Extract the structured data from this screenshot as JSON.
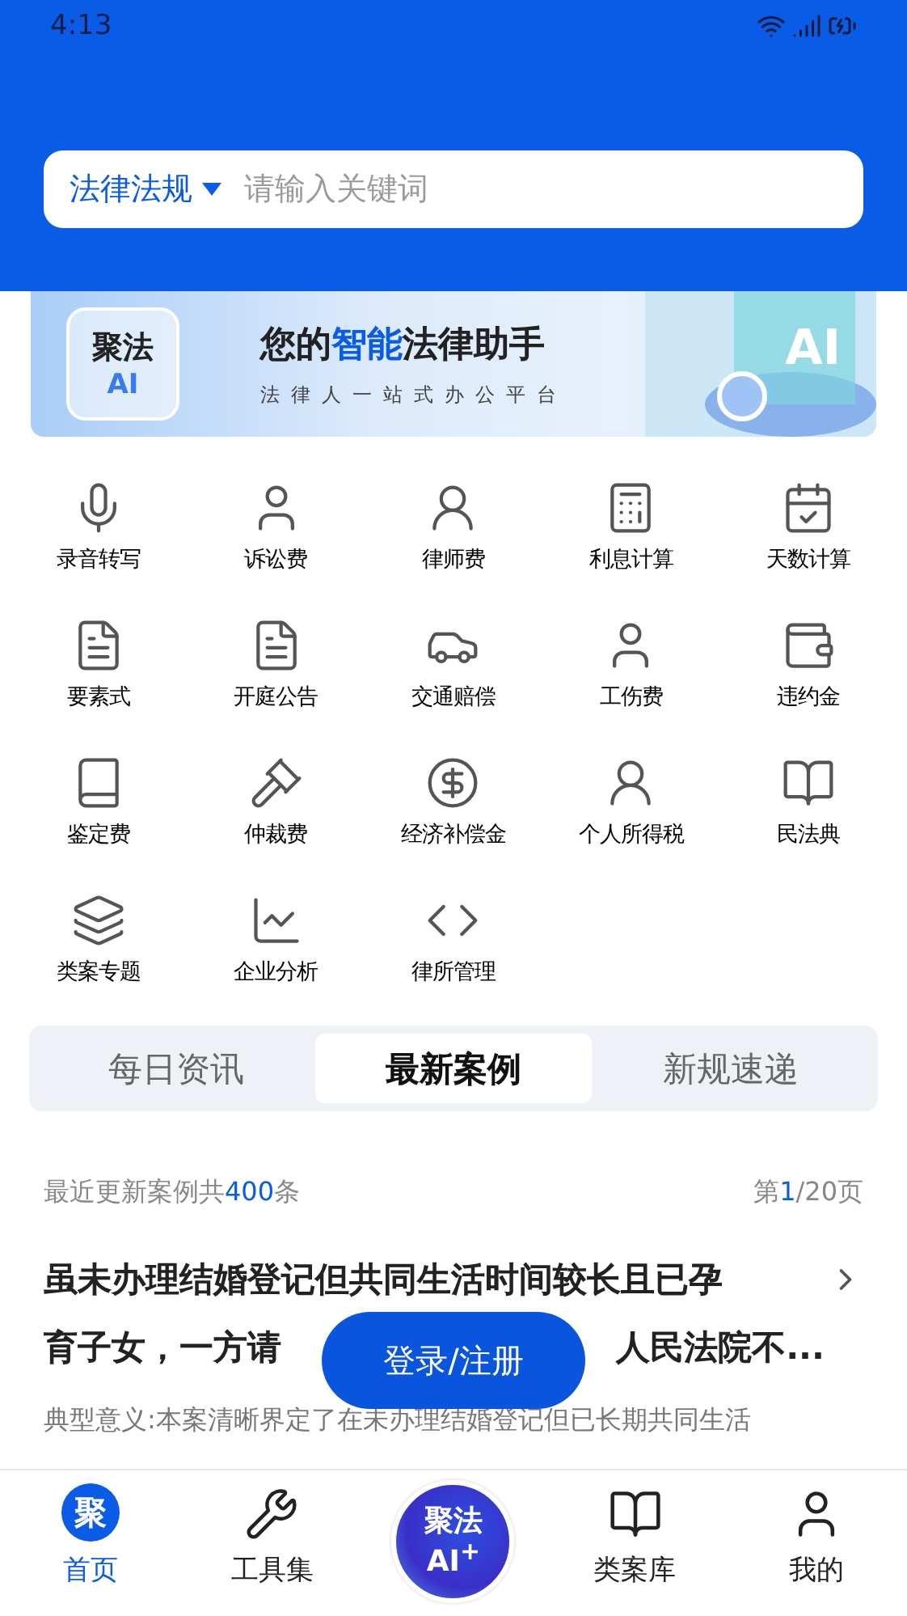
{
  "status_bar": {
    "time": "4:13"
  },
  "search": {
    "scope": "法律法规",
    "placeholder": "请输入关键词"
  },
  "banner": {
    "badge_top": "聚法",
    "badge_bottom": "AI",
    "headline_before": "您的",
    "headline_highlight": "智能",
    "headline_after": "法律助手",
    "subline": "法律人一站式办公平台",
    "art_label": "AI"
  },
  "tools": [
    {
      "label": "录音转写"
    },
    {
      "label": "诉讼费"
    },
    {
      "label": "律师费"
    },
    {
      "label": "利息计算"
    },
    {
      "label": "天数计算"
    },
    {
      "label": "要素式"
    },
    {
      "label": "开庭公告"
    },
    {
      "label": "交通赔偿"
    },
    {
      "label": "工伤费"
    },
    {
      "label": "违约金"
    },
    {
      "label": "鉴定费"
    },
    {
      "label": "仲裁费"
    },
    {
      "label": "经济补偿金"
    },
    {
      "label": "个人所得税"
    },
    {
      "label": "民法典"
    },
    {
      "label": "类案专题"
    },
    {
      "label": "企业分析"
    },
    {
      "label": "律所管理"
    }
  ],
  "tabs": [
    {
      "label": "每日资讯",
      "selected": false
    },
    {
      "label": "最新案例",
      "selected": true
    },
    {
      "label": "新规速递",
      "selected": false
    }
  ],
  "summary": {
    "count_prefix": "最近更新案例共",
    "count": "400",
    "count_suffix": "条",
    "page_prefix": "第",
    "page": "1",
    "page_suffix": "/20页"
  },
  "case": {
    "title_line_1": "虽未办理结婚登记但共同生活时间较长且已孕",
    "title_line_2_start": "育子女，一方请",
    "title_line_2_end": "人民法院不...",
    "description": "典型意义:本案清晰界定了在未办理结婚登记但已长期共同生活"
  },
  "login_button": "登录/注册",
  "nav": [
    {
      "label": "首页",
      "selected": true,
      "kind": "home",
      "glyph": "聚"
    },
    {
      "label": "工具集",
      "selected": false,
      "kind": "tools"
    },
    {
      "kind": "ai",
      "line_1": "聚法",
      "line_2": "AI$^{+}$"
    },
    {
      "label": "类案库",
      "selected": false,
      "kind": "library"
    },
    {
      "label": "我的",
      "selected": false,
      "kind": "profile"
    }
  ]
}
